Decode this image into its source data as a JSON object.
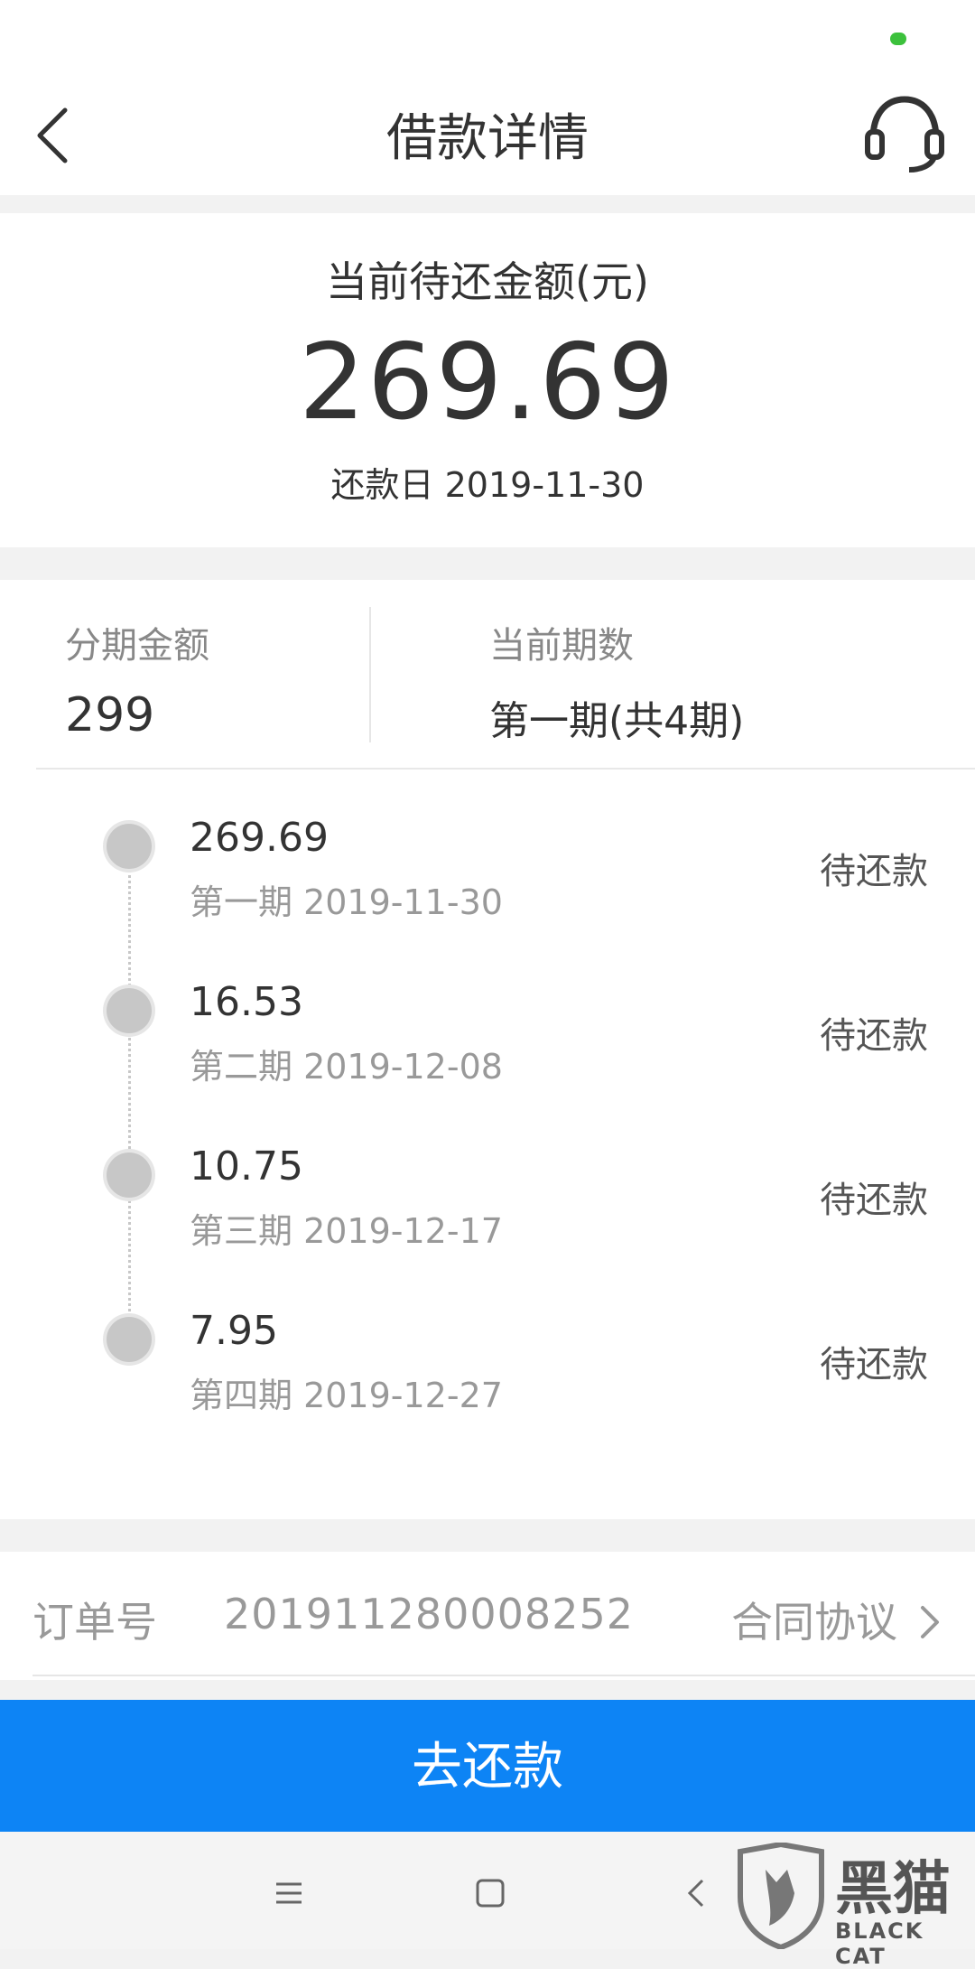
{
  "header": {
    "title": "借款详情"
  },
  "summary": {
    "label": "当前待还金额(元)",
    "amount": "269.69",
    "due_date": "还款日 2019-11-30"
  },
  "plan": {
    "installment_amount_label": "分期金额",
    "installment_amount": "299",
    "current_period_label": "当前期数",
    "current_period": "第一期(共4期)"
  },
  "installments": [
    {
      "amount": "269.69",
      "period": "第一期 2019-11-30",
      "status": "待还款"
    },
    {
      "amount": "16.53",
      "period": "第二期 2019-12-08",
      "status": "待还款"
    },
    {
      "amount": "10.75",
      "period": "第三期 2019-12-17",
      "status": "待还款"
    },
    {
      "amount": "7.95",
      "period": "第四期 2019-12-27",
      "status": "待还款"
    }
  ],
  "order": {
    "label": "订单号",
    "number": "201911280008252",
    "contract_link": "合同协议"
  },
  "actions": {
    "repay_button": "去还款"
  },
  "watermark": {
    "text": "黑猫",
    "subtext": "BLACK CAT"
  },
  "colors": {
    "accent": "#0d84f5",
    "status_dot": "#3cc13c",
    "timeline_dot": "#c7c7c7"
  }
}
